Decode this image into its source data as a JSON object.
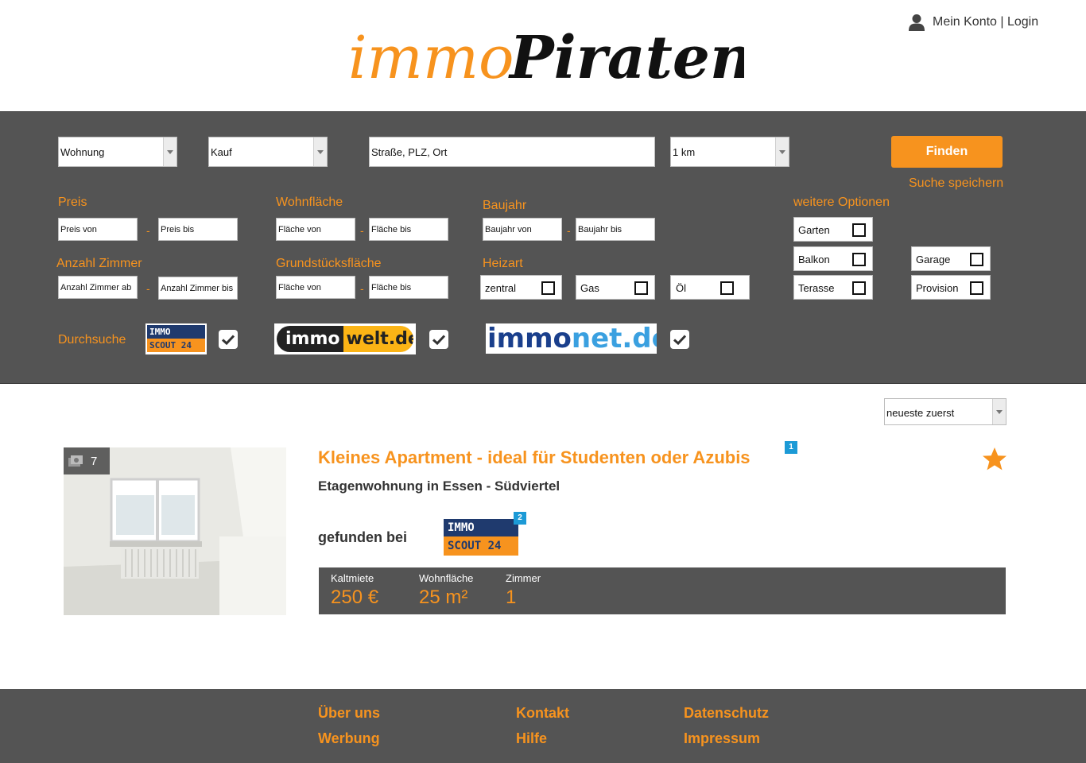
{
  "header": {
    "logo_text": "immoPiraten",
    "account_label": "Mein Konto | Login"
  },
  "search": {
    "property_type": "Wohnung",
    "offer_type": "Kauf",
    "location_placeholder": "Straße, PLZ, Ort",
    "radius": "1 km",
    "find_button": "Finden",
    "save_search": "Suche speichern",
    "price": {
      "label": "Preis",
      "from": "Preis von",
      "to": "Preis bis"
    },
    "living_area": {
      "label": "Wohnfläche",
      "from": "Fläche von",
      "to": "Fläche bis"
    },
    "build_year": {
      "label": "Baujahr",
      "from": "Baujahr von",
      "to": "Baujahr bis"
    },
    "rooms": {
      "label": "Anzahl Zimmer",
      "from": "Anzahl Zimmer ab",
      "to": "Anzahl Zimmer bis"
    },
    "plot_area": {
      "label": "Grundstücksfläche",
      "from": "Fläche von",
      "to": "Fläche bis"
    },
    "heating": {
      "label": "Heizart",
      "options": [
        "zentral",
        "Gas",
        "Öl"
      ]
    },
    "more_options": {
      "label": "weitere Optionen",
      "options": [
        "Garten",
        "Balkon",
        "Terasse",
        "Garage",
        "Provision"
      ]
    },
    "dash": "-",
    "portals": {
      "label": "Durchsuche",
      "items": [
        {
          "name": "IMMO SCOUT24",
          "line1": "IMMO",
          "line2": "SCOUT 24",
          "checked": true
        },
        {
          "name": "immowelt.de",
          "part1": "immo",
          "part2": "welt.de",
          "checked": true
        },
        {
          "name": "immonet.de",
          "part1": "immo",
          "part2": "net.de",
          "checked": true
        }
      ]
    }
  },
  "results": {
    "sort": "neueste zuerst",
    "listing": {
      "photo_count": "7",
      "title": "Kleines Apartment - ideal für Studenten oder Azubis",
      "title_badge": "1",
      "subtitle": "Etagenwohnung in Essen - Südviertel",
      "found_at_label": "gefunden bei",
      "source_logo": {
        "line1": "IMMO",
        "line2": "SCOUT 24",
        "badge": "2"
      },
      "stats": [
        {
          "label": "Kaltmiete",
          "value": "250 €"
        },
        {
          "label": "Wohnfläche",
          "value": "25 m²"
        },
        {
          "label": "Zimmer",
          "value": "1"
        }
      ]
    }
  },
  "footer": {
    "links": [
      "Über uns",
      "Werbung",
      "Kontakt",
      "Hilfe",
      "Datenschutz",
      "Impressum"
    ]
  },
  "colors": {
    "accent": "#f7931e",
    "panel": "#545454",
    "badge": "#1c9ad6",
    "immoscout_blue": "#1f3a6e",
    "immonet_blue": "#1a3f8c"
  }
}
